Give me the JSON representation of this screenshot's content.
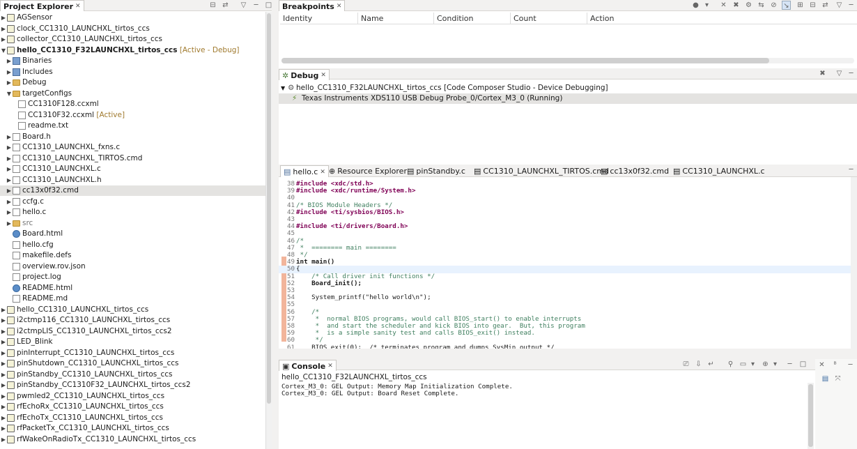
{
  "project_explorer": {
    "title": "Project Explorer",
    "items": [
      {
        "label": "AGSensor",
        "suffix": "",
        "level": 0,
        "arrow": "▶",
        "icon": "project",
        "bold": false
      },
      {
        "label": "clock_CC1310_LAUNCHXL_tirtos_ccs",
        "suffix": "",
        "level": 0,
        "arrow": "▶",
        "icon": "project",
        "bold": false
      },
      {
        "label": "collector_CC1310_LAUNCHXL_tirtos_ccs",
        "suffix": "",
        "level": 0,
        "arrow": "▶",
        "icon": "project",
        "bold": false
      },
      {
        "label": "hello_CC1310_F32LAUNCHXL_tirtos_ccs",
        "suffix": " [Active - Debug]",
        "level": 0,
        "arrow": "▼",
        "icon": "project",
        "bold": true
      },
      {
        "label": "Binaries",
        "suffix": "",
        "level": 1,
        "arrow": "▶",
        "icon": "bin",
        "bold": false
      },
      {
        "label": "Includes",
        "suffix": "",
        "level": 1,
        "arrow": "▶",
        "icon": "bin",
        "bold": false
      },
      {
        "label": "Debug",
        "suffix": "",
        "level": 1,
        "arrow": "▶",
        "icon": "folder",
        "bold": false
      },
      {
        "label": "targetConfigs",
        "suffix": "",
        "level": 1,
        "arrow": "▼",
        "icon": "folder",
        "bold": false
      },
      {
        "label": "CC1310F128.ccxml",
        "suffix": "",
        "level": 2,
        "arrow": "",
        "icon": "file",
        "bold": false
      },
      {
        "label": "CC1310F32.ccxml",
        "suffix": " [Active]",
        "level": 2,
        "arrow": "",
        "icon": "file",
        "bold": false
      },
      {
        "label": "readme.txt",
        "suffix": "",
        "level": 2,
        "arrow": "",
        "icon": "file",
        "bold": false
      },
      {
        "label": "Board.h",
        "suffix": "",
        "level": 1,
        "arrow": "▶",
        "icon": "cfile",
        "bold": false
      },
      {
        "label": "CC1310_LAUNCHXL_fxns.c",
        "suffix": "",
        "level": 1,
        "arrow": "▶",
        "icon": "cfile",
        "bold": false
      },
      {
        "label": "CC1310_LAUNCHXL_TIRTOS.cmd",
        "suffix": "",
        "level": 1,
        "arrow": "▶",
        "icon": "cfile",
        "bold": false
      },
      {
        "label": "CC1310_LAUNCHXL.c",
        "suffix": "",
        "level": 1,
        "arrow": "▶",
        "icon": "cfile",
        "bold": false
      },
      {
        "label": "CC1310_LAUNCHXL.h",
        "suffix": "",
        "level": 1,
        "arrow": "▶",
        "icon": "cfile",
        "bold": false
      },
      {
        "label": "cc13x0f32.cmd",
        "suffix": "",
        "level": 1,
        "arrow": "▶",
        "icon": "cfile",
        "bold": false,
        "selected": true
      },
      {
        "label": "ccfg.c",
        "suffix": "",
        "level": 1,
        "arrow": "▶",
        "icon": "cfile",
        "bold": false
      },
      {
        "label": "hello.c",
        "suffix": "",
        "level": 1,
        "arrow": "▶",
        "icon": "cfile",
        "bold": false
      },
      {
        "label": "src",
        "suffix": "",
        "level": 1,
        "arrow": "▶",
        "icon": "folder",
        "bold": false,
        "muted": true
      },
      {
        "label": "Board.html",
        "suffix": "",
        "level": 1,
        "arrow": "",
        "icon": "web",
        "bold": false
      },
      {
        "label": "hello.cfg",
        "suffix": "",
        "level": 1,
        "arrow": "",
        "icon": "file",
        "bold": false
      },
      {
        "label": "makefile.defs",
        "suffix": "",
        "level": 1,
        "arrow": "",
        "icon": "file",
        "bold": false
      },
      {
        "label": "overview.rov.json",
        "suffix": "",
        "level": 1,
        "arrow": "",
        "icon": "file",
        "bold": false
      },
      {
        "label": "project.log",
        "suffix": "",
        "level": 1,
        "arrow": "",
        "icon": "file",
        "bold": false
      },
      {
        "label": "README.html",
        "suffix": "",
        "level": 1,
        "arrow": "",
        "icon": "web",
        "bold": false
      },
      {
        "label": "README.md",
        "suffix": "",
        "level": 1,
        "arrow": "",
        "icon": "file",
        "bold": false
      },
      {
        "label": "hello_CC1310_LAUNCHXL_tirtos_ccs",
        "suffix": "",
        "level": 0,
        "arrow": "▶",
        "icon": "project",
        "bold": false
      },
      {
        "label": "i2ctmp116_CC1310_LAUNCHXL_tirtos_ccs",
        "suffix": "",
        "level": 0,
        "arrow": "▶",
        "icon": "project",
        "bold": false
      },
      {
        "label": "i2ctmpLIS_CC1310_LAUNCHXL_tirtos_ccs2",
        "suffix": "",
        "level": 0,
        "arrow": "▶",
        "icon": "project",
        "bold": false
      },
      {
        "label": "LED_Blink",
        "suffix": "",
        "level": 0,
        "arrow": "▶",
        "icon": "project",
        "bold": false
      },
      {
        "label": "pinInterrupt_CC1310_LAUNCHXL_tirtos_ccs",
        "suffix": "",
        "level": 0,
        "arrow": "▶",
        "icon": "project",
        "bold": false
      },
      {
        "label": "pinShutdown_CC1310_LAUNCHXL_tirtos_ccs",
        "suffix": "",
        "level": 0,
        "arrow": "▶",
        "icon": "project",
        "bold": false
      },
      {
        "label": "pinStandby_CC1310_LAUNCHXL_tirtos_ccs",
        "suffix": "",
        "level": 0,
        "arrow": "▶",
        "icon": "project",
        "bold": false
      },
      {
        "label": "pinStandby_CC1310F32_LAUNCHXL_tirtos_ccs2",
        "suffix": "",
        "level": 0,
        "arrow": "▶",
        "icon": "project",
        "bold": false
      },
      {
        "label": "pwmled2_CC1310_LAUNCHXL_tirtos_ccs",
        "suffix": "",
        "level": 0,
        "arrow": "▶",
        "icon": "project",
        "bold": false
      },
      {
        "label": "rfEchoRx_CC1310_LAUNCHXL_tirtos_ccs",
        "suffix": "",
        "level": 0,
        "arrow": "▶",
        "icon": "project",
        "bold": false
      },
      {
        "label": "rfEchoTx_CC1310_LAUNCHXL_tirtos_ccs",
        "suffix": "",
        "level": 0,
        "arrow": "▶",
        "icon": "project",
        "bold": false
      },
      {
        "label": "rfPacketTx_CC1310_LAUNCHXL_tirtos_ccs",
        "suffix": "",
        "level": 0,
        "arrow": "▶",
        "icon": "project",
        "bold": false
      },
      {
        "label": "rfWakeOnRadioTx_CC1310_LAUNCHXL_tirtos_ccs",
        "suffix": "",
        "level": 0,
        "arrow": "▶",
        "icon": "project",
        "bold": false
      }
    ]
  },
  "breakpoints": {
    "title": "Breakpoints",
    "columns": [
      "Identity",
      "Name",
      "Condition",
      "Count",
      "Action"
    ]
  },
  "debug": {
    "title": "Debug",
    "session": "hello_CC1310_F32LAUNCHXL_tirtos_ccs [Code Composer Studio - Device Debugging]",
    "target": "Texas Instruments XDS110 USB Debug Probe_0/Cortex_M3_0 (Running)"
  },
  "editor": {
    "tabs": [
      "hello.c",
      "Resource Explorer",
      "pinStandby.c",
      "CC1310_LAUNCHXL_TIRTOS.cmd",
      "cc13x0f32.cmd",
      "CC1310_LAUNCHXL.c"
    ],
    "lines": [
      {
        "n": "38",
        "t": "#include <xdc/std.h>",
        "k": "pp"
      },
      {
        "n": "39",
        "t": "#include <xdc/runtime/System.h>",
        "k": "pp"
      },
      {
        "n": "40",
        "t": "",
        "k": ""
      },
      {
        "n": "41",
        "t": "/* BIOS Module Headers */",
        "k": "cm"
      },
      {
        "n": "42",
        "t": "#include <ti/sysbios/BIOS.h>",
        "k": "pp"
      },
      {
        "n": "43",
        "t": "",
        "k": ""
      },
      {
        "n": "44",
        "t": "#include <ti/drivers/Board.h>",
        "k": "pp"
      },
      {
        "n": "45",
        "t": "",
        "k": ""
      },
      {
        "n": "46",
        "t": "/*",
        "k": "cm"
      },
      {
        "n": "47",
        "t": " *  ======== main ========",
        "k": "cm"
      },
      {
        "n": "48",
        "t": " */",
        "k": "cm"
      },
      {
        "n": "49",
        "t": "int main()",
        "k": "fn"
      },
      {
        "n": "50",
        "t": "{",
        "k": "cur"
      },
      {
        "n": "51",
        "t": "    /* Call driver init functions */",
        "k": "cm"
      },
      {
        "n": "52",
        "t": "    Board_init();",
        "k": "b"
      },
      {
        "n": "53",
        "t": "",
        "k": ""
      },
      {
        "n": "54",
        "t": "    System_printf(\"hello world\\n\");",
        "k": "s"
      },
      {
        "n": "55",
        "t": "",
        "k": ""
      },
      {
        "n": "56",
        "t": "    /*",
        "k": "cm"
      },
      {
        "n": "57",
        "t": "     *  normal BIOS programs, would call BIOS_start() to enable interrupts",
        "k": "cm"
      },
      {
        "n": "58",
        "t": "     *  and start the scheduler and kick BIOS into gear.  But, this program",
        "k": "cm"
      },
      {
        "n": "59",
        "t": "     *  is a simple sanity test and calls BIOS_exit() instead.",
        "k": "cm"
      },
      {
        "n": "60",
        "t": "     */",
        "k": "cm"
      },
      {
        "n": "61",
        "t": "    BIOS_exit(0);  /* terminates program and dumps SysMin output */",
        "k": ""
      }
    ]
  },
  "console": {
    "title": "Console",
    "subtitle": "hello_CC1310_F32LAUNCHXL_tirtos_ccs",
    "lines": [
      "Cortex_M3_0: GEL Output: Memory Map Initialization Complete.",
      "Cortex_M3_0: GEL Output: Board Reset Complete."
    ]
  }
}
